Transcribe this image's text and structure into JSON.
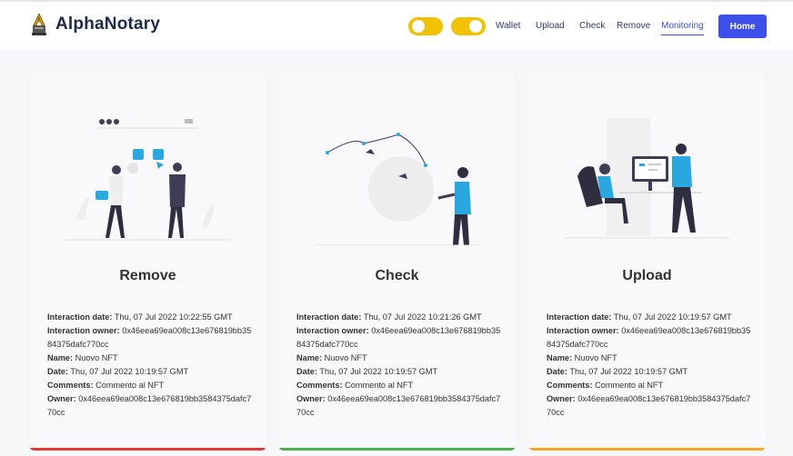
{
  "brand": {
    "name": "AlphaNotary",
    "logo_icon": "notary-a-logo-icon"
  },
  "nav": {
    "links": [
      "Wallet",
      "Upload",
      "Check",
      "Remove",
      "Monitoring"
    ],
    "active": "Monitoring",
    "home_label": "Home",
    "toggle_color": "#f2c200",
    "accent_color": "#3d4fe8"
  },
  "cards": [
    {
      "title": "Remove",
      "status_color": "#e53935",
      "illustration": "social-media-illustration",
      "fields": [
        {
          "label": "Interaction date:",
          "value": "Thu, 07 Jul 2022 10:22:55 GMT"
        },
        {
          "label": "Interaction owner:",
          "value": "0x46eea69ea008c13e676819bb3584375dafc770cc"
        },
        {
          "label": "Name:",
          "value": "Nuovo NFT"
        },
        {
          "label": "Date:",
          "value": "Thu, 07 Jul 2022 10:19:57 GMT"
        },
        {
          "label": "Comments:",
          "value": "Commento al NFT"
        },
        {
          "label": "Owner:",
          "value": "0x46eea69ea008c13e676819bb3584375dafc770cc"
        }
      ]
    },
    {
      "title": "Check",
      "status_color": "#4caf50",
      "illustration": "design-tools-illustration",
      "fields": [
        {
          "label": "Interaction date:",
          "value": "Thu, 07 Jul 2022 10:21:26 GMT"
        },
        {
          "label": "Interaction owner:",
          "value": "0x46eea69ea008c13e676819bb3584375dafc770cc"
        },
        {
          "label": "Name:",
          "value": "Nuovo NFT"
        },
        {
          "label": "Date:",
          "value": "Thu, 07 Jul 2022 10:19:57 GMT"
        },
        {
          "label": "Comments:",
          "value": "Commento al NFT"
        },
        {
          "label": "Owner:",
          "value": "0x46eea69ea008c13e676819bb3584375dafc770cc"
        }
      ]
    },
    {
      "title": "Upload",
      "status_color": "#f5a623",
      "illustration": "office-computer-illustration",
      "fields": [
        {
          "label": "Interaction date:",
          "value": "Thu, 07 Jul 2022 10:19:57 GMT"
        },
        {
          "label": "Interaction owner:",
          "value": "0x46eea69ea008c13e676819bb3584375dafc770cc"
        },
        {
          "label": "Name:",
          "value": "Nuovo NFT"
        },
        {
          "label": "Date:",
          "value": "Thu, 07 Jul 2022 10:19:57 GMT"
        },
        {
          "label": "Comments:",
          "value": "Commento al NFT"
        },
        {
          "label": "Owner:",
          "value": "0x46eea69ea008c13e676819bb3584375dafc770cc"
        }
      ]
    }
  ]
}
